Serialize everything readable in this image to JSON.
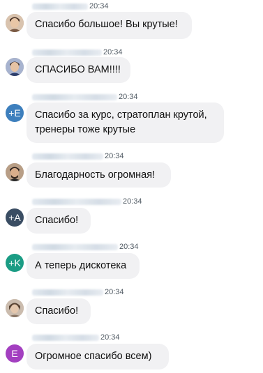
{
  "messages": [
    {
      "avatar": {
        "type": "photo",
        "icon": "user-photo-icon",
        "color": "#8a6a4e"
      },
      "time": "20:34",
      "text": "Спасибо большое! Вы крутые!"
    },
    {
      "avatar": {
        "type": "photo",
        "icon": "user-photo-icon",
        "color": "#4a5a86"
      },
      "time": "20:34",
      "text": "СПАСИБО ВАМ!!!!"
    },
    {
      "avatar": {
        "type": "initial",
        "initial": "+E",
        "color": "#3d7fbd"
      },
      "time": "20:34",
      "text": "Спасибо за курс, стратоплан крутой, тренеры тоже крутые"
    },
    {
      "avatar": {
        "type": "photo",
        "icon": "user-photo-icon",
        "color": "#6b5a4a"
      },
      "time": "20:34",
      "text": "Благодарность огромная!"
    },
    {
      "avatar": {
        "type": "initial",
        "initial": "+A",
        "color": "#3a4d63"
      },
      "time": "20:34",
      "text": "Спасибо!"
    },
    {
      "avatar": {
        "type": "initial",
        "initial": "+K",
        "color": "#1b9c84"
      },
      "time": "20:34",
      "text": "А теперь дискотека"
    },
    {
      "avatar": {
        "type": "photo",
        "icon": "user-photo-icon",
        "color": "#9c8a7a"
      },
      "time": "20:34",
      "text": "Спасибо!"
    },
    {
      "avatar": {
        "type": "initial",
        "initial": "E",
        "color": "#a33fc0"
      },
      "time": "20:34",
      "text": "Огромное спасибо всем)"
    }
  ]
}
